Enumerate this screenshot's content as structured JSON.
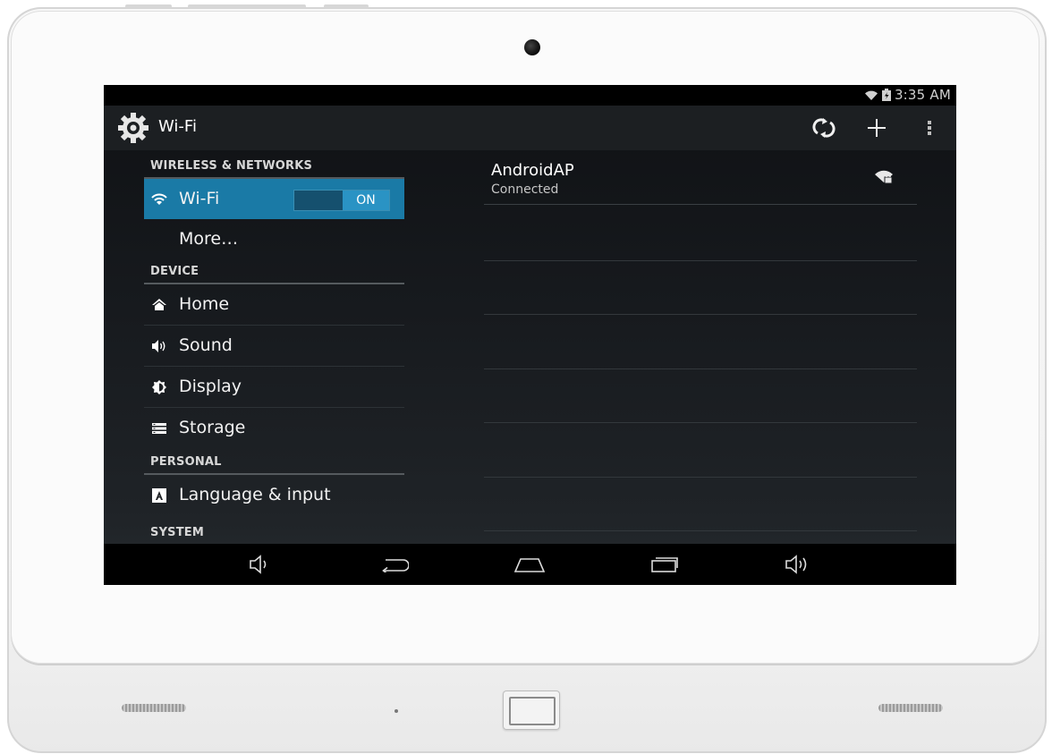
{
  "status_bar": {
    "time": "3:35 AM",
    "wifi_icon": "wifi-icon",
    "battery_icon": "battery-icon"
  },
  "action_bar": {
    "title": "Wi-Fi",
    "app_icon": "settings-gear-icon",
    "actions": [
      "wps-icon",
      "add-icon",
      "overflow-menu-icon"
    ]
  },
  "settings": {
    "sections": [
      {
        "header": "WIRELESS & NETWORKS"
      },
      {
        "header": "DEVICE"
      },
      {
        "header": "PERSONAL"
      },
      {
        "header": "SYSTEM"
      }
    ],
    "items": {
      "wifi": {
        "label": "Wi-Fi",
        "icon": "wifi-icon",
        "toggle": "ON",
        "selected": true
      },
      "more": {
        "label": "More…"
      },
      "home": {
        "label": "Home",
        "icon": "home-icon"
      },
      "sound": {
        "label": "Sound",
        "icon": "speaker-icon"
      },
      "display": {
        "label": "Display",
        "icon": "brightness-icon"
      },
      "storage": {
        "label": "Storage",
        "icon": "storage-icon"
      },
      "language": {
        "label": "Language & input",
        "icon": "keyboard-icon"
      }
    }
  },
  "networks": [
    {
      "ssid": "AndroidAP",
      "status": "Connected",
      "icon": "wifi-locked-signal-icon"
    }
  ],
  "nav_bar": [
    "volume-down-icon",
    "back-icon",
    "home-icon",
    "recent-apps-icon",
    "volume-up-icon"
  ],
  "colors": {
    "accent": "#1a7aa6",
    "toggle_on": "#2a93c4",
    "screen_bg": "#171a1e"
  }
}
